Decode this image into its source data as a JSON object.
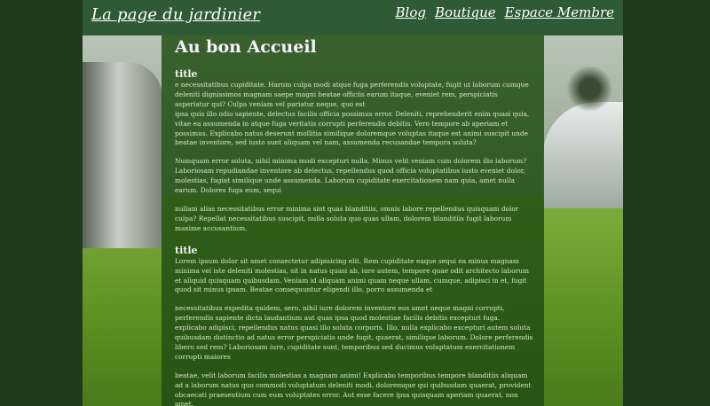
{
  "header": {
    "brand": "La page du jardinier",
    "nav": [
      "Blog",
      "Boutique",
      "Espace Membre"
    ]
  },
  "main": {
    "title": "Au bon Accueil",
    "sections": [
      {
        "title": "title",
        "paragraphs": [
          "e necessitatibus cupiditate. Harum culpa modi atque fuga perferendis voluptate, fugit ut laborum cumque deleniti dignissimos magnam saepe magni beatae officiis earum itaque, eveniet rem, perspiciatis asperiatur qui? Culpa veniam vel pariatur neque, quo est",
          "ipsa quis illo odio sapiente, delectus facilis officia possimus error. Deleniti, reprehenderit enim quasi quia, vitae ea assumenda in atque fuga veritatis corrupti perferendis debitis. Vero tempore ab aperiam et possimus. Explicabo natus deserunt mollitia similique doloremque voluptas itaque est animi suscipit unde beatae inventore, sed iusto sunt aliquam vel nam, assumenda recusandae tempora soluta?",
          "Numquam error soluta, nihil minima modi excepturi nulla. Minus velit veniam cum dolorem illo laborum? Laboriosam repudiandae inventore ab delectus, repellendus quod officia voluptatibus iusto eveniet dolor, molestias, fugiat similique unde assumenda. Laborum cupiditate exercitationem nam quia, amet nulla earum. Dolores fuga eum, sequi",
          "nullam alias necessitatibus error minima sint quas blanditiis, omnis labore repellendus quisquam dolor culpa? Repellat necessitatibus suscipit, nulla soluta quo quas ullam, dolorem blanditiis fugit laborum maxime accusantium."
        ]
      },
      {
        "title": "title",
        "paragraphs": [
          "Lorem ipsum dolor sit amet consectetur adipisicing elit. Rem cupiditate eaque sequi ea minus magnam minima vel iste deleniti molestias, sit in natus quasi ab, iure autem, tempore quae odit architecto laborum et aliquid quisquam quibusdam. Veniam id aliquam animi quam neque ullam, cumque, adipisci in et, fugit quod sit minus ipsam. Beatae consequuntur eligendi illo, porro assumenda et",
          "necessitatibus expedita quidem, sero, nihil iure dolorem inventore eos amet neque magni corrupti, perferendis sapiente dicta laudantium aut quas ipsa quod molestiae facilis debitis excepturi fuga. explicabo adipisci, repellendus natus quasi illo soluta corporis. Illo, nulla explicabo excepturi autem soluta quibusdam distinctio ad natus error perspiciatis unde fugit, quaerat, similique laborum. Dolore perferendis libero sed rem? Laboriosam iure, cupiditate sunt, temporibus sed ducimus voluptatum exercitationem corrupti maiores",
          "beatae, velit laborum facilis molestias a magnam animi! Explicabo temporibus tempore blanditiis aliquam ad a laborum natus quo commodi voluptatum deleniti modi, doloremque qui quibusdam quaerat, provident obcaecati praesentium cum eum voluptates error. Aut esse facere ipsa quisquam aperiam quaerat, non amet."
        ]
      }
    ]
  }
}
